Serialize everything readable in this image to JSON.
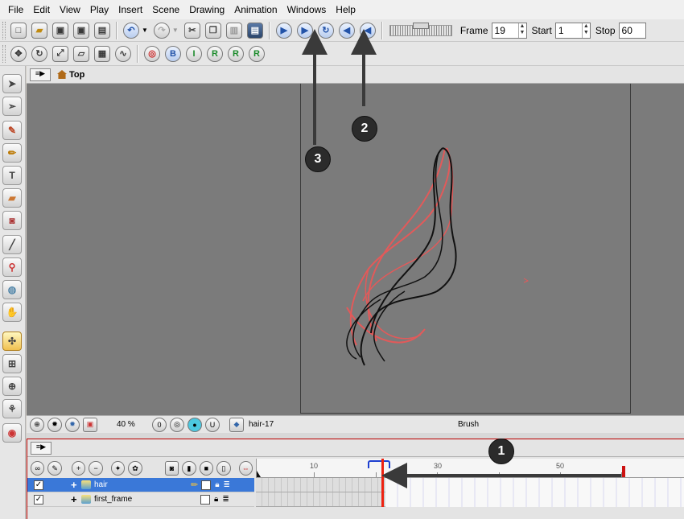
{
  "menu": [
    "File",
    "Edit",
    "View",
    "Play",
    "Insert",
    "Scene",
    "Drawing",
    "Animation",
    "Windows",
    "Help"
  ],
  "frame_controls": {
    "frame_label": "Frame",
    "frame_value": "19",
    "start_label": "Start",
    "start_value": "1",
    "stop_label": "Stop",
    "stop_value": "60"
  },
  "view": {
    "name": "Top"
  },
  "status": {
    "zoom": "40 %",
    "layer": "hair-17",
    "tool": "Brush"
  },
  "timeline": {
    "ruler_labels": [
      "10",
      "30",
      "50"
    ],
    "layers": [
      {
        "name": "hair",
        "selected": true
      },
      {
        "name": "first_frame",
        "selected": false
      }
    ],
    "current_frame": 19
  },
  "callouts": [
    "1",
    "2",
    "3"
  ],
  "colors": {
    "onion_skin": "#e25a5a",
    "stroke": "#111111",
    "playhead": "#e21111",
    "selection": "#3a78d8"
  }
}
